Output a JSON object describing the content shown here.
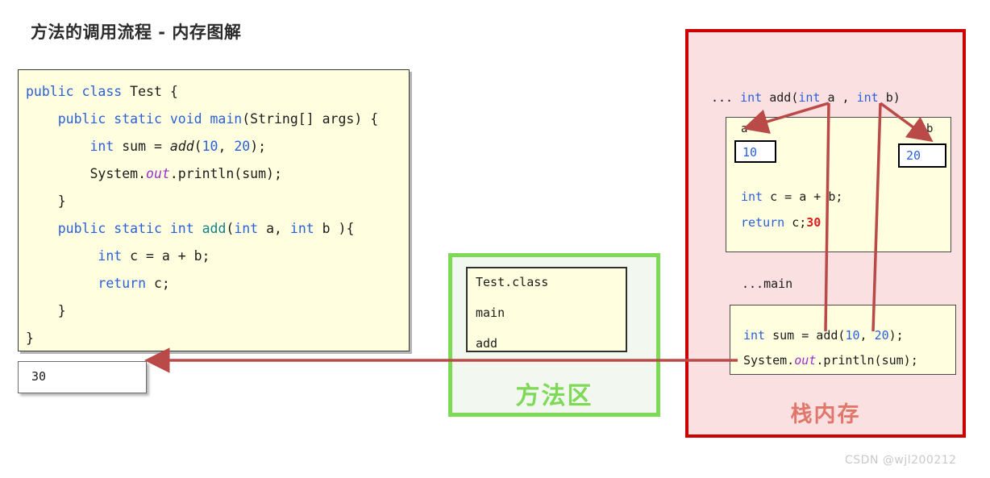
{
  "page": {
    "title": "方法的调用流程 - 内存图解",
    "watermark": "CSDN @wjl200212"
  },
  "source_code": {
    "lines": [
      "public class Test {",
      "    public static void main(String[] args) {",
      "        int sum = add(10, 20);",
      "        System.out.println(sum);",
      "    }",
      "    public static int add(int a, int b ){",
      "         int c = a + b;",
      "         return c;",
      "    }",
      "}"
    ]
  },
  "console": {
    "value": "30"
  },
  "method_area": {
    "label": "方法区",
    "entries": [
      "Test.class",
      "main",
      "add"
    ]
  },
  "stack_memory": {
    "label": "栈内存",
    "add_frame": {
      "header": "... int add(int a , int b)",
      "param_a_label": "a",
      "param_a_value": "10",
      "param_b_label": "b",
      "param_b_value": "20",
      "line_1": "int c = a + b;",
      "line_2": "return c;",
      "return_value": "30"
    },
    "main_frame": {
      "header": "...main",
      "line_1": "int sum = add(10, 20);",
      "line_2": "System.out.println(sum);"
    }
  },
  "colors": {
    "stack_border": "#cc0000",
    "stack_fill": "#fbe0e2",
    "stack_label": "#e0776a",
    "method_border": "#7ed957",
    "method_fill": "#f2f8ef",
    "arrow": "#b94a48",
    "code_fill": "#ffffe0",
    "keyword": "#2b5fd9",
    "field": "#9b30c9",
    "return_value": "#e01b1b"
  }
}
